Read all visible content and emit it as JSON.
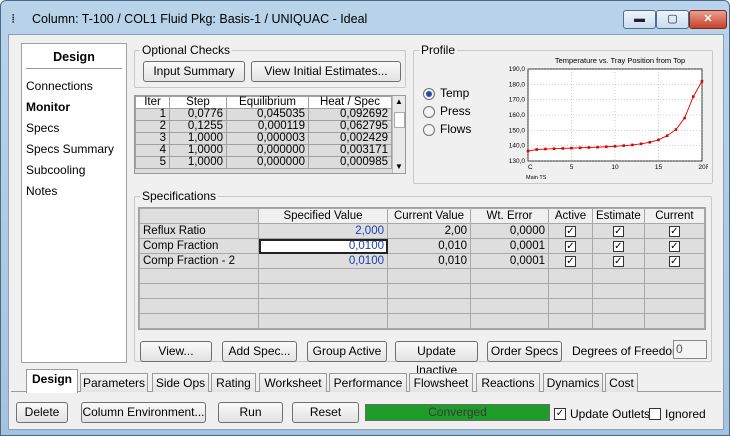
{
  "window": {
    "title": "Column: T-100 / COL1  Fluid Pkg: Basis-1 / UNIQUAC - Ideal",
    "icon": "column-icon",
    "buttons": [
      "minimize",
      "maximize",
      "close"
    ]
  },
  "left_panel": {
    "heading": "Design",
    "items": [
      "Connections",
      "Monitor",
      "Specs",
      "Specs Summary",
      "Subcooling",
      "Notes"
    ],
    "selected": "Monitor"
  },
  "optional_checks": {
    "title": "Optional Checks",
    "input_summary": "Input Summary",
    "view_initial": "View Initial Estimates..."
  },
  "iterations": {
    "headers": [
      "Iter",
      "Step",
      "Equilibrium",
      "Heat / Spec"
    ],
    "rows": [
      [
        "1",
        "0,0776",
        "0,045035",
        "0,092692"
      ],
      [
        "2",
        "0,1255",
        "0,000119",
        "0,062795"
      ],
      [
        "3",
        "1,0000",
        "0,000003",
        "0,002429"
      ],
      [
        "4",
        "1,0000",
        "0,000000",
        "0,003171"
      ],
      [
        "5",
        "1,0000",
        "0,000000",
        "0,000985"
      ]
    ]
  },
  "profile": {
    "title": "Profile",
    "options": [
      "Temp",
      "Press",
      "Flows"
    ],
    "selected": "Temp"
  },
  "chart_data": {
    "type": "line",
    "title": "Temperature vs. Tray Position from Top",
    "xlabel": "Main TS",
    "ylabel": "",
    "xlim": [
      0,
      20
    ],
    "ylim": [
      130,
      190
    ],
    "xticks": [
      "C",
      "5",
      "10",
      "15",
      "20",
      "R"
    ],
    "yticks": [
      "130,0",
      "140,0",
      "150,0",
      "160,0",
      "170,0",
      "180,0",
      "190,0"
    ],
    "x": [
      0,
      1,
      2,
      3,
      4,
      5,
      6,
      7,
      8,
      9,
      10,
      11,
      12,
      13,
      14,
      15,
      16,
      17,
      18,
      19,
      20
    ],
    "series": [
      {
        "values": [
          136.5,
          137.5,
          137.8,
          138.0,
          138.2,
          138.4,
          138.6,
          138.8,
          139.0,
          139.3,
          139.6,
          140.0,
          140.5,
          141.2,
          142.2,
          143.8,
          146.5,
          150.5,
          158.0,
          172.0,
          182.0
        ]
      }
    ],
    "color": "#e00000"
  },
  "specifications": {
    "title": "Specifications",
    "headers": [
      "",
      "Specified Value",
      "Current Value",
      "Wt. Error",
      "Active",
      "Estimate",
      "Current"
    ],
    "rows": [
      {
        "name": "Reflux Ratio",
        "specified": "2,000",
        "current": "2,00",
        "error": "0,0000",
        "active": true,
        "estimate": true,
        "current_chk": true
      },
      {
        "name": "Comp Fraction",
        "specified": "0,0100",
        "current": "0,010",
        "error": "0,0001",
        "active": true,
        "estimate": true,
        "current_chk": true
      },
      {
        "name": "Comp Fraction - 2",
        "specified": "0,0100",
        "current": "0,010",
        "error": "0,0001",
        "active": true,
        "estimate": true,
        "current_chk": true
      }
    ],
    "blue": "#1f3fb0"
  },
  "spec_buttons": {
    "view": "View...",
    "add": "Add Spec...",
    "group": "Group Active",
    "update": "Update Inactive",
    "order": "Order Specs",
    "dof_label": "Degrees of Freedom",
    "dof_value": "0"
  },
  "tabs": [
    "Design",
    "Parameters",
    "Side Ops",
    "Rating",
    "Worksheet",
    "Performance",
    "Flowsheet",
    "Reactions",
    "Dynamics",
    "Cost"
  ],
  "footer": {
    "delete": "Delete",
    "column_env": "Column Environment...",
    "run": "Run",
    "reset": "Reset",
    "status": "Converged",
    "update_outlets": "Update Outlets",
    "ignored": "Ignored"
  }
}
